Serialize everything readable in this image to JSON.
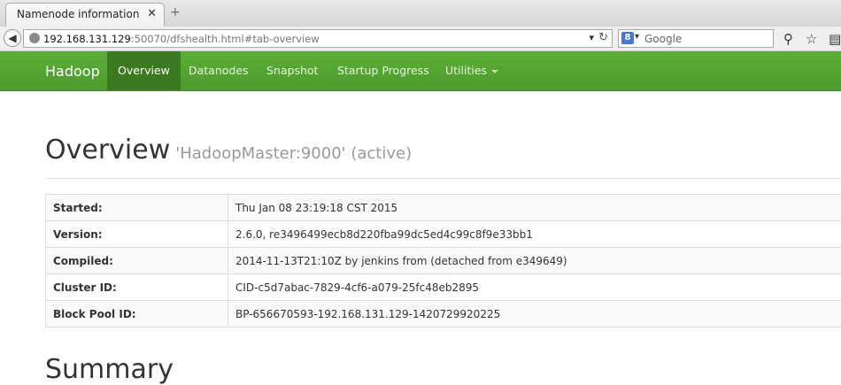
{
  "browser": {
    "tab_title": "Namenode information",
    "tab_close": "✕",
    "new_tab": "+",
    "url_host": "192.168.131.129",
    "url_rest": ":50070/dfshealth.html#tab-overview",
    "search_engine_icon": "8",
    "search_placeholder": "Google"
  },
  "hadoop_nav": {
    "brand": "Hadoop",
    "items": [
      "Overview",
      "Datanodes",
      "Snapshot",
      "Startup Progress",
      "Utilities"
    ],
    "active_index": 0
  },
  "overview": {
    "title": "Overview",
    "subtitle": "'HadoopMaster:9000' (active)"
  },
  "info_table": [
    {
      "key": "Started:",
      "value": "Thu Jan 08 23:19:18 CST 2015"
    },
    {
      "key": "Version:",
      "value": "2.6.0, re3496499ecb8d220fba99dc5ed4c99c8f9e33bb1"
    },
    {
      "key": "Compiled:",
      "value": "2014-11-13T21:10Z by jenkins from (detached from e349649)"
    },
    {
      "key": "Cluster ID:",
      "value": "CID-c5d7abac-7829-4cf6-a079-25fc48eb2895"
    },
    {
      "key": "Block Pool ID:",
      "value": "BP-656670593-192.168.131.129-1420729920225"
    }
  ],
  "summary_title": "Summary",
  "colors": {
    "nav_green": "#5cae37",
    "nav_active": "#3b7a21"
  }
}
